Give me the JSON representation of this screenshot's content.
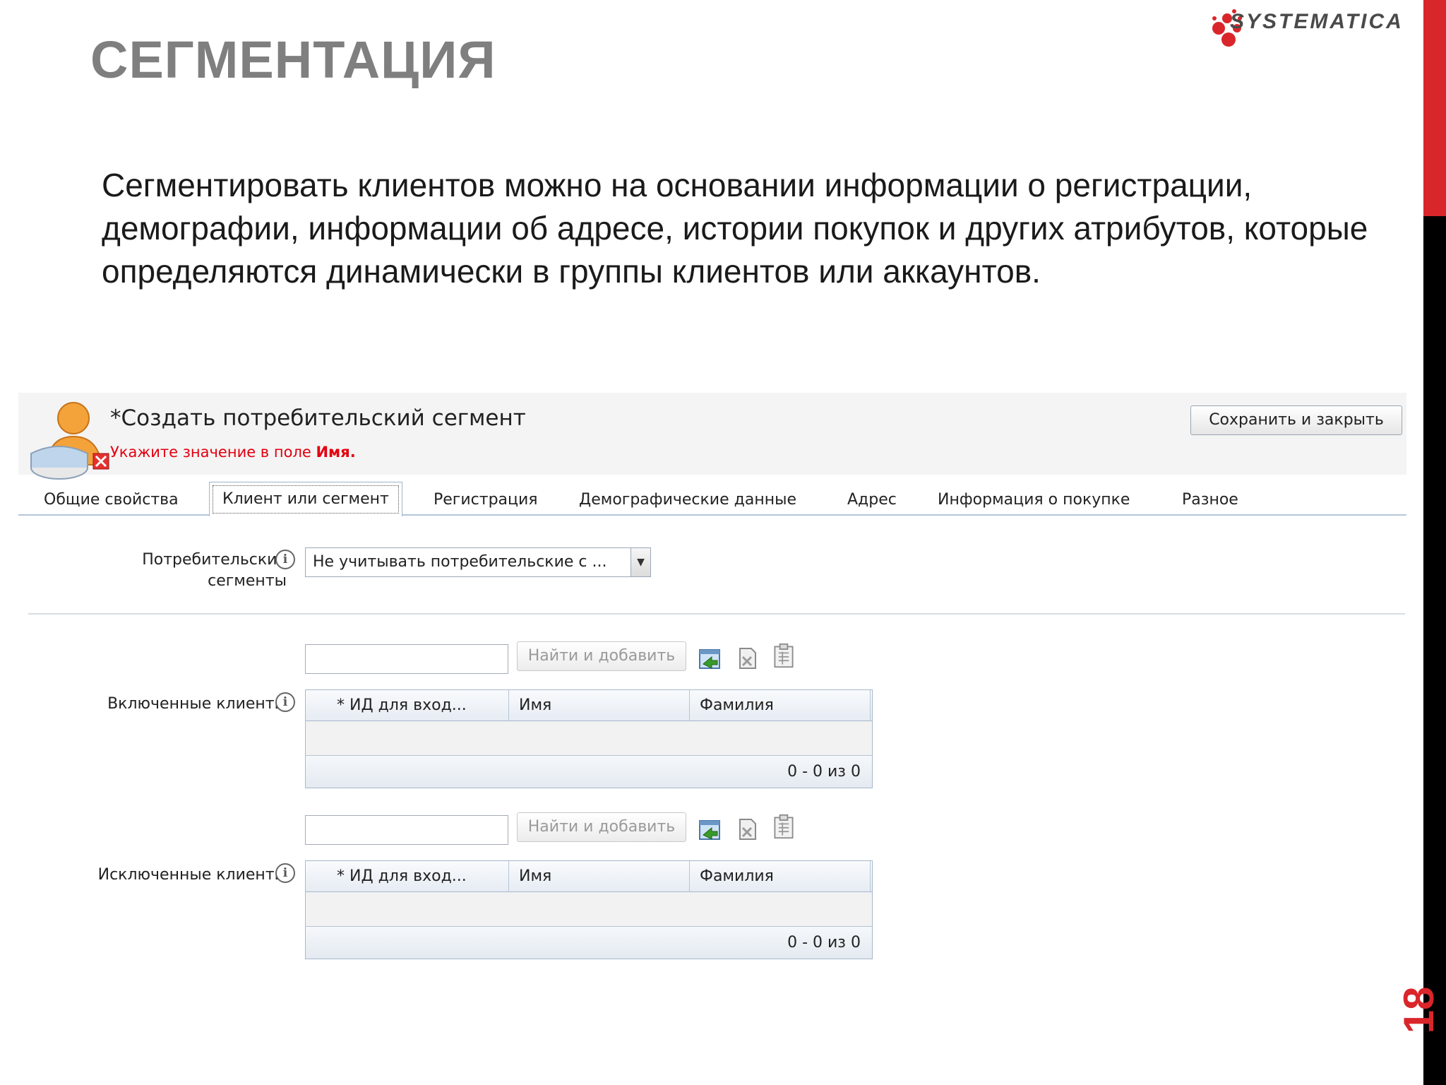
{
  "slide": {
    "title": "СЕГМЕНТАЦИЯ",
    "logo_text": "SYSTEMATICA",
    "page_number": "18",
    "intro_text": "Сегментировать клиентов можно на основании информации о регистрации, демографии, информации об адресе, истории покупок и других атрибутов, которые определяются динамически в группы клиентов или аккаунтов.",
    "accent_color": "#d9262b"
  },
  "form": {
    "title": "*Создать потребительский сегмент",
    "error_prefix": "Укажите значение в поле ",
    "error_field": "Имя.",
    "error_color": "#e4000f",
    "save_button": "Сохранить и закрыть",
    "tabs": [
      {
        "label": "Общие свойства"
      },
      {
        "label": "Клиент или сегмент",
        "active": true
      },
      {
        "label": "Регистрация"
      },
      {
        "label": "Демографические данные"
      },
      {
        "label": "Адрес"
      },
      {
        "label": "Информация о покупке"
      },
      {
        "label": "Разное"
      }
    ],
    "consumer_segments": {
      "label_line1": "Потребительские",
      "label_line2": "сегменты",
      "selected_value": "Не учитывать потребительские с ...",
      "info_icon": "info-icon"
    },
    "included": {
      "label": "Включенные клиенты",
      "find_button": "Найти и добавить",
      "columns": [
        "* ИД для вход...",
        "Имя",
        "Фамилия"
      ],
      "count": "0 - 0 из 0",
      "search_value": ""
    },
    "excluded": {
      "label": "Исключенные клиенты",
      "find_button": "Найти и добавить",
      "columns": [
        "* ИД для вход...",
        "Имя",
        "Фамилия"
      ],
      "count": "0 - 0 из 0",
      "search_value": ""
    },
    "icons": [
      "import-icon",
      "remove-icon",
      "clipboard-icon"
    ]
  }
}
